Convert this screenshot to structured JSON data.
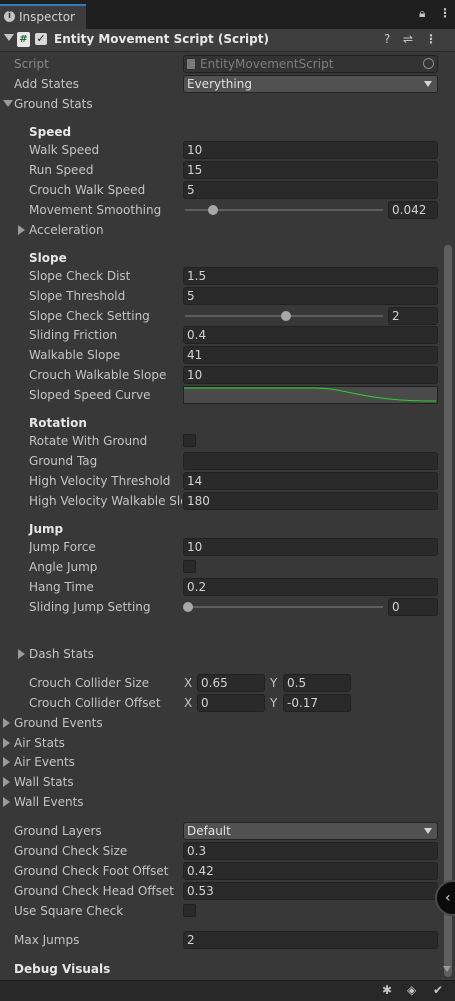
{
  "tab": {
    "title": "Inspector"
  },
  "component": {
    "title": "Entity Movement Script (Script)",
    "script_icon": "#"
  },
  "script": {
    "label": "Script",
    "value": "EntityMovementScript"
  },
  "add_states": {
    "label": "Add States",
    "value": "Everything"
  },
  "ground_stats": {
    "label": "Ground Stats"
  },
  "speed": {
    "header": "Speed",
    "walk_speed": {
      "label": "Walk Speed",
      "value": "10"
    },
    "run_speed": {
      "label": "Run Speed",
      "value": "15"
    },
    "crouch_walk_speed": {
      "label": "Crouch Walk Speed",
      "value": "5"
    },
    "movement_smoothing": {
      "label": "Movement Smoothing",
      "value": "0.042",
      "slider_fraction": 0.042
    },
    "acceleration": {
      "label": "Acceleration"
    }
  },
  "slope": {
    "header": "Slope",
    "slope_check_dist": {
      "label": "Slope Check Dist",
      "value": "1.5"
    },
    "slope_threshold": {
      "label": "Slope Threshold",
      "value": "5"
    },
    "slope_check_setting": {
      "label": "Slope Check Setting",
      "value": "2",
      "slider_fraction": 0.5
    },
    "sliding_friction": {
      "label": "Sliding Friction",
      "value": "0.4"
    },
    "walkable_slope": {
      "label": "Walkable Slope",
      "value": "41"
    },
    "crouch_walkable_slope": {
      "label": "Crouch Walkable Slope",
      "value": "10"
    },
    "sloped_speed_curve": {
      "label": "Sloped Speed Curve",
      "curve_color": "#2bd12b"
    }
  },
  "rotation": {
    "header": "Rotation",
    "rotate_with_ground": {
      "label": "Rotate With Ground"
    },
    "ground_tag": {
      "label": "Ground Tag",
      "value": ""
    },
    "high_velocity_threshold": {
      "label": "High Velocity Threshold",
      "value": "14"
    },
    "high_velocity_walkable_slope": {
      "label": "High Velocity Walkable Slop",
      "value": "180"
    }
  },
  "jump": {
    "header": "Jump",
    "jump_force": {
      "label": "Jump Force",
      "value": "10"
    },
    "angle_jump": {
      "label": "Angle Jump"
    },
    "hang_time": {
      "label": "Hang Time",
      "value": "0.2"
    },
    "sliding_jump_setting": {
      "label": "Sliding Jump Setting",
      "value": "0",
      "slider_fraction": 0
    }
  },
  "dash_stats": {
    "label": "Dash Stats"
  },
  "crouch_collider_size": {
    "label": "Crouch Collider Size",
    "x_label": "X",
    "x": "0.65",
    "y_label": "Y",
    "y": "0.5"
  },
  "crouch_collider_offset": {
    "label": "Crouch Collider Offset",
    "x_label": "X",
    "x": "0",
    "y_label": "Y",
    "y": "-0.17"
  },
  "foldouts": {
    "ground_events": "Ground Events",
    "air_stats": "Air Stats",
    "air_events": "Air Events",
    "wall_stats": "Wall Stats",
    "wall_events": "Wall Events"
  },
  "ground_layers": {
    "label": "Ground Layers",
    "value": "Default"
  },
  "ground_check_size": {
    "label": "Ground Check Size",
    "value": "0.3"
  },
  "ground_check_foot_offset": {
    "label": "Ground Check Foot Offset",
    "value": "0.42"
  },
  "ground_check_head_offset": {
    "label": "Ground Check Head Offset",
    "value": "0.53"
  },
  "use_square_check": {
    "label": "Use Square Check"
  },
  "max_jumps": {
    "label": "Max Jumps",
    "value": "2"
  },
  "debug_visuals": {
    "label": "Debug Visuals"
  },
  "colors": {
    "background": "#383838",
    "field": "#2a2a2a",
    "accent_tab": "#3a79bb"
  }
}
